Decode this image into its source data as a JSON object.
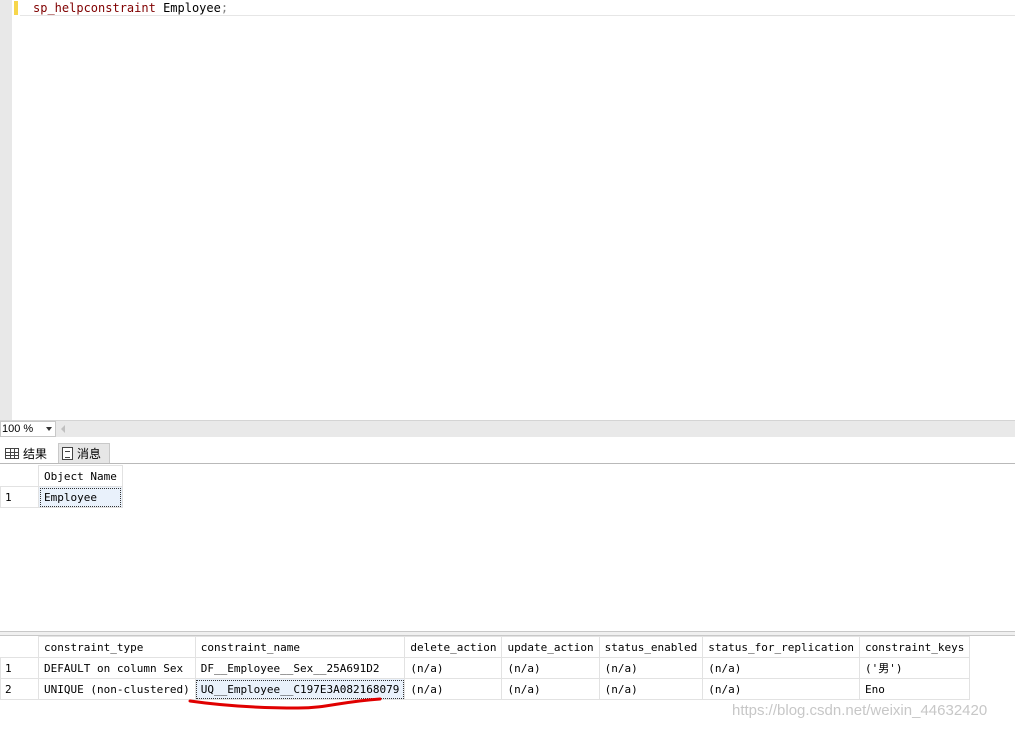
{
  "editor": {
    "proc": "sp_helpconstraint",
    "table": "Employee",
    "terminator": ";"
  },
  "zoom": {
    "value": "100 %"
  },
  "tabs": [
    {
      "label": "结果",
      "icon": "grid-icon"
    },
    {
      "label": "消息",
      "icon": "message-icon"
    }
  ],
  "result1": {
    "columns": [
      "Object Name"
    ],
    "rows": [
      {
        "num": "1",
        "cells": [
          "Employee"
        ]
      }
    ]
  },
  "result2": {
    "columns": [
      "constraint_type",
      "constraint_name",
      "delete_action",
      "update_action",
      "status_enabled",
      "status_for_replication",
      "constraint_keys"
    ],
    "rows": [
      {
        "num": "1",
        "cells": [
          "DEFAULT on column Sex",
          "DF__Employee__Sex__25A691D2",
          "(n/a)",
          "(n/a)",
          "(n/a)",
          "(n/a)",
          "('男')"
        ]
      },
      {
        "num": "2",
        "cells": [
          "UNIQUE (non-clustered)",
          "UQ__Employee__C197E3A082168079",
          "(n/a)",
          "(n/a)",
          "(n/a)",
          "(n/a)",
          "Eno"
        ]
      }
    ]
  },
  "watermark": "https://blog.csdn.net/weixin_44632420",
  "colors": {
    "annotation": "#e00000",
    "selection": "#e9f1fb",
    "proc_keyword": "#800000"
  }
}
